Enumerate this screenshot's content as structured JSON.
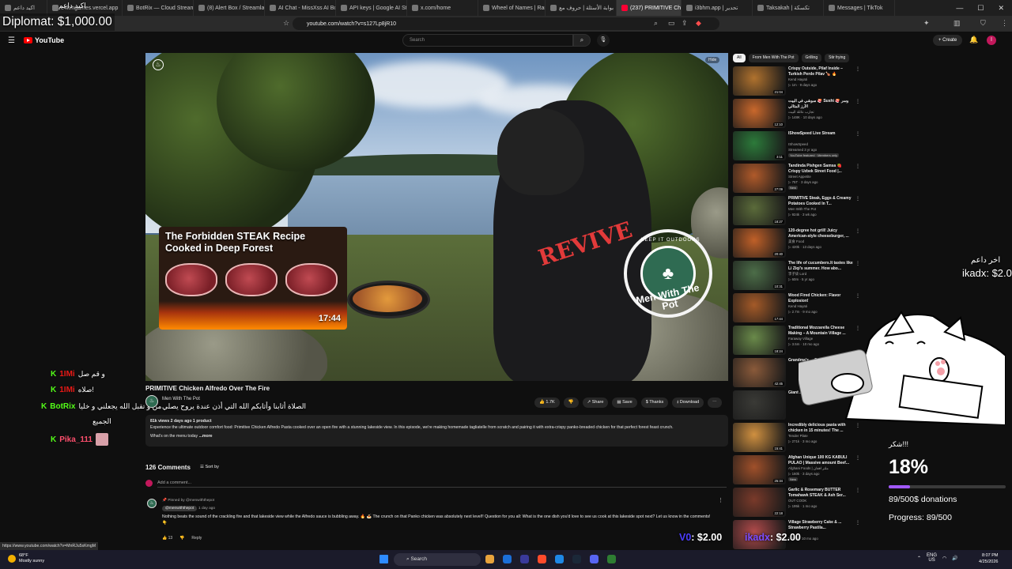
{
  "browser": {
    "tabs": [
      {
        "label": "اكيد داعم",
        "active": false
      },
      {
        "label": "e4kmgames.vercel.app",
        "active": false
      },
      {
        "label": "BotRix — Cloud Stream",
        "active": false
      },
      {
        "label": "(8) Alert Box / Streamlab",
        "active": false
      },
      {
        "label": "AI Chat - MissXss AI Bot",
        "active": false
      },
      {
        "label": "API keys | Google AI Stud",
        "active": false
      },
      {
        "label": "x.com/home",
        "active": false
      },
      {
        "label": "Wheel of Names | Rand",
        "active": false
      },
      {
        "label": "بوابة الأسئلة | حروف مع",
        "active": false
      },
      {
        "label": "(237) PRIMITIVE Ch",
        "active": true
      },
      {
        "label": "i3bhm.app | تحدير",
        "active": false
      },
      {
        "label": "Taksakah | تكسكة",
        "active": false
      },
      {
        "label": "Messages | TikTok",
        "active": false
      }
    ],
    "url": "youtube.com/watch?v=s127Lp8jR10",
    "status_url": "https://www.youtube.com/watch?v=MnRJu5sKmgM"
  },
  "youtube": {
    "logo": "YouTube",
    "search_placeholder": "Search",
    "create_label": "Create",
    "avatar_letter": "I"
  },
  "player": {
    "hide_label": "Hide",
    "thumb_title": "The Forbidden STEAK Recipe Cooked in Deep Forest",
    "thumb_duration": "17:44",
    "badge_top": "KEEP IT OUTDOORS",
    "badge_text": "Men With The Pot",
    "rv_text": "REVIVE"
  },
  "video": {
    "title": "PRIMITIVE Chicken Alfredo Over The Fire",
    "channel": "Men With The Pot",
    "actions": {
      "likes": "1.7K",
      "share": "Share",
      "save": "Save",
      "thanks": "Thanks",
      "download": "Download"
    },
    "desc_stats": "81k views  2 days ago  1 product",
    "desc_text": "Experience the ultimate outdoor comfort food: Primitive Chicken Alfredo Pasta cooked over an open fire with a stunning lakeside view. In this episode, we're making homemade tagliatelle from scratch and pairing it with extra-crispy panko-breaded chicken for that perfect forest feast crunch.",
    "desc_menu": "What's on the menu today",
    "desc_more": "...more"
  },
  "comments": {
    "count": "126 Comments",
    "sort_label": "Sort by",
    "add_placeholder": "Add a comment...",
    "pinned_label": "Pinned by @menwiththepot",
    "author": "@menwiththepot",
    "time": "1 day ago",
    "text": "Nothing beats the sound of the crackling fire and that lakeside view while the Alfredo sauce is bubbling away. 🔥 🍝 The crunch on that Panko chicken was absolutely next level!! Question for you all: What is the one dish you'd love to see us cook at this lakeside spot next? Let us know in the comments! 👇",
    "likes": "13",
    "reply": "Reply"
  },
  "sidebar": {
    "chips": [
      "All",
      "From Men With The Pot",
      "Grilling",
      "Stir frying"
    ],
    "items": [
      {
        "title": "Crispy Outside, Pilaf Inside – Turkish Perde Pilav 🍗 🔥",
        "channel": "Kend Hayati",
        "meta": "▷ 1m · 9 days ago",
        "badge": "",
        "duration": "21:04",
        "color": "#b0722e"
      },
      {
        "title": "سوشي في البيت 🍣 Sushi 🍣 وسر الأرز المثالي",
        "channel": "تجارب عائلة البيت",
        "meta": "▷ 148K · 10 days ago",
        "badge": "",
        "duration": "12:10",
        "color": "#c9682c"
      },
      {
        "title": "IShowSpeed Live Stream",
        "channel": "IShowSpeed",
        "meta": "Streamed 3 yr ago",
        "badge": "YouTube featured · Members only",
        "duration": "3:11",
        "color": "#2c7a3a"
      },
      {
        "title": "Tandinda Pishgen Samsa 🍓 Crispy Uzbek Street Food |...",
        "channel": "Street Appetite",
        "meta": "▷ 75T · 3 days ago",
        "badge": "New",
        "duration": "27:09",
        "color": "#b05a2a"
      },
      {
        "title": "PRIMITIVE Steak, Eggs & Creamy Potatoes Cooked In T...",
        "channel": "Men With The Pot",
        "meta": "▷ 924k · 3 wk ago",
        "badge": "",
        "duration": "18:27",
        "color": "#5b6b3a"
      },
      {
        "title": "120-degree hot grill! Juicy American-style cheeseburger, ...",
        "channel": "美食 Food",
        "meta": "▷ 420k · 13 days ago",
        "badge": "",
        "duration": "20:40",
        "color": "#c06028"
      },
      {
        "title": "The life of cucumbers.It tastes like Li Ziqi's summer. How abo...",
        "channel": "李子柒 Lord",
        "meta": "▷ 60m · 5 yr ago",
        "badge": "",
        "duration": "10:31",
        "color": "#4c6d48"
      },
      {
        "title": "Wood Fired Chicken: Flavor Explosion!",
        "channel": "Kend Hayati",
        "meta": "▷ 2.7m · 9 mo ago",
        "badge": "",
        "duration": "17:44",
        "color": "#a45a28"
      },
      {
        "title": "Traditional Mozzarella Cheese Making – A Mountain Village ...",
        "channel": "Faraway Village",
        "meta": "▷ 3.5m · 10 mo ago",
        "badge": "",
        "duration": "18:24",
        "color": "#6a8a4a"
      },
      {
        "title": "Grandma's ... Cooking",
        "channel": "",
        "meta": "",
        "badge": "",
        "duration": "42:45",
        "color": "#8a5a3a"
      },
      {
        "title": "Giant ... Cook",
        "channel": "",
        "meta": "",
        "badge": "",
        "duration": "",
        "color": "#3a3a36"
      },
      {
        "title": "Incredibly delicious pasta with chicken in 15 minutes! The ...",
        "channel": "Tender Plate",
        "meta": "▷ 271k · 3 mo ago",
        "badge": "",
        "duration": "15:41",
        "color": "#d09040"
      },
      {
        "title": "Afghan Unique 100 KG KABULI PULAO | Massive amount Beef...",
        "channel": "Afghani Foods | ملتر افغان",
        "meta": "▷ 160k · 3 days ago",
        "badge": "New",
        "duration": "25:34",
        "color": "#a0502a"
      },
      {
        "title": "Garlic & Rosemary BUTTER Tomahawk STEAK & Ash Ser...",
        "channel": "OUT COOK",
        "meta": "▷ 195k · 1 mo ago",
        "badge": "",
        "duration": "22:18",
        "color": "#7a3a2a"
      },
      {
        "title": "Village Strawberry Cake & ... Strawberry Pastila...",
        "channel": "",
        "meta": "▷ 12m · 10 mo ago",
        "badge": "",
        "duration": "",
        "color": "#b04a4a"
      }
    ]
  },
  "overlays": {
    "diplomat": "Diplomat: $1,000.00",
    "top_arabic": "اكيد داعم",
    "chat": [
      {
        "user": "1IMi",
        "message": "و قم صل",
        "color": "#e91916"
      },
      {
        "user": "1IMi",
        "message": "صلاه!",
        "color": "#e91916"
      },
      {
        "user": "BotRix",
        "message": "من و تقبل الله يجعلني و خليا",
        "color": "#53fc18"
      },
      {
        "user": "",
        "message": "الجميع",
        "color": "#ffffff"
      },
      {
        "user": "Pika_111",
        "message": "",
        "color": "#ff4f6d"
      }
    ],
    "prayer_text": "الصلاة أثابنا وأثابكم الله التي أذن عندة يروح يصلي",
    "right_arabic": "اخر داعم",
    "right_name": "ikadx: $2.0",
    "goal": {
      "shukr": "شكر!!!",
      "percent_text": "18%",
      "percent": 0.18,
      "donations": "89/500$ donations",
      "progress": "Progress: 89/500"
    },
    "alert_v0_name": "V0",
    "alert_v0_amount": ": $2.00",
    "alert_ikadx_name": "ikadx",
    "alert_ikadx_amount": ": $2.00"
  },
  "taskbar": {
    "weather_temp": "68°F",
    "weather_desc": "Mostly sunny",
    "search": "Search",
    "lang": "ENG",
    "lang2": "US",
    "time": "8:07 PM",
    "date": "4/25/2026"
  }
}
